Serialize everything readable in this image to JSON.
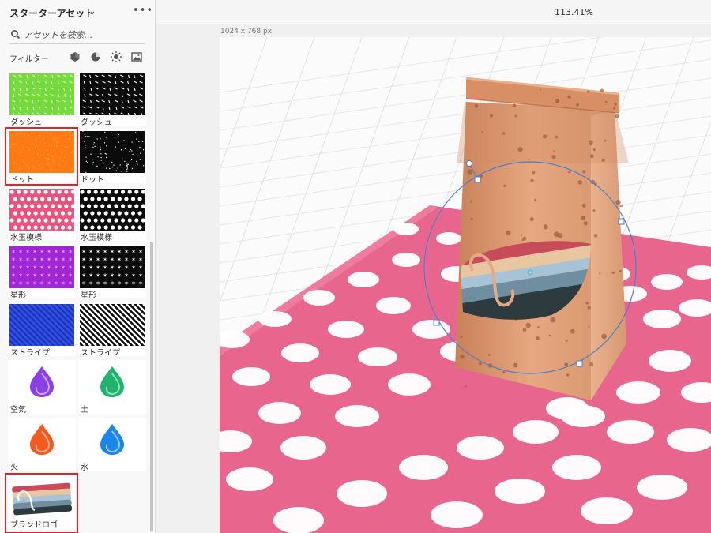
{
  "panel": {
    "title": "スターターアセット",
    "search_placeholder": "アセットを検索...",
    "filter_label": "フィルター",
    "filters": [
      "materials-filter-icon",
      "light-filter-icon",
      "sun-filter-icon",
      "image-filter-icon"
    ]
  },
  "assets": [
    {
      "label": "ダッシュ",
      "pattern": "dash-light",
      "bg": "#76d93d"
    },
    {
      "label": "ダッシュ",
      "pattern": "dash-dark",
      "bg": "#0b0b0b"
    },
    {
      "label": "ドット",
      "pattern": "dot-orange",
      "bg": "#ff7a12",
      "selected": true
    },
    {
      "label": "ドット",
      "pattern": "dot-dark",
      "bg": "#0b0b0b"
    },
    {
      "label": "水玉模様",
      "pattern": "polka-pink",
      "bg": "#e9547e"
    },
    {
      "label": "水玉模様",
      "pattern": "polka-dark",
      "bg": "#0b0b0b"
    },
    {
      "label": "星形",
      "pattern": "star-purple",
      "bg": "#a126d6"
    },
    {
      "label": "星形",
      "pattern": "star-dark",
      "bg": "#0b0b0b"
    },
    {
      "label": "ストライプ",
      "pattern": "stripe-blue",
      "bg": "#2f50e6"
    },
    {
      "label": "ストライプ",
      "pattern": "stripe-dark",
      "bg": "#0b0b0b"
    },
    {
      "label": "空気",
      "icon": "air-drop-icon",
      "color": "#8b3fe6"
    },
    {
      "label": "土",
      "icon": "earth-drop-icon",
      "color": "#1fb36e"
    },
    {
      "label": "火",
      "icon": "fire-drop-icon",
      "color": "#f45a1e"
    },
    {
      "label": "水",
      "icon": "water-drop-icon",
      "color": "#1b86e8"
    },
    {
      "label": "ブランドロゴ",
      "icon": "brand-logo-icon",
      "selected": true
    }
  ],
  "canvas": {
    "zoom": "113.41%",
    "artboard_size": "1024 x 768 px"
  },
  "colors": {
    "selection": "#e3232a",
    "tablecloth": "#e8668e",
    "bag": "#d9956c",
    "gizmo": "#4a7fd0"
  }
}
